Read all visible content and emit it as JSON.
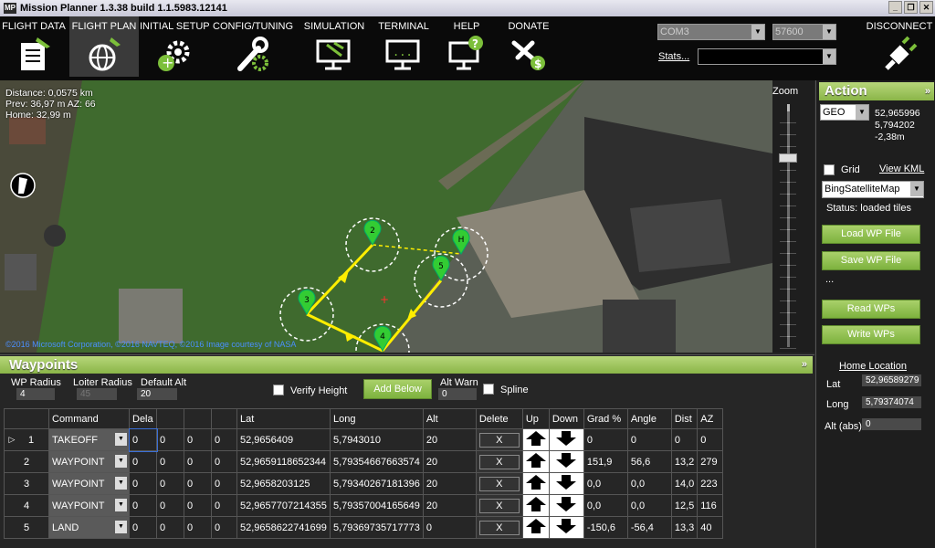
{
  "window": {
    "title": "Mission Planner 1.3.38 build 1.1.5983.12141",
    "logo": "MP"
  },
  "menu": [
    {
      "label": "FLIGHT DATA",
      "icon": "flight-data-icon"
    },
    {
      "label": "FLIGHT PLAN",
      "icon": "flight-plan-icon"
    },
    {
      "label": "INITIAL SETUP",
      "icon": "initial-setup-icon"
    },
    {
      "label": "CONFIG/TUNING",
      "icon": "config-tuning-icon"
    },
    {
      "label": "SIMULATION",
      "icon": "simulation-icon"
    },
    {
      "label": "TERMINAL",
      "icon": "terminal-icon"
    },
    {
      "label": "HELP",
      "icon": "help-icon"
    },
    {
      "label": "DONATE",
      "icon": "donate-icon"
    }
  ],
  "connection": {
    "port": "COM3",
    "baud": "57600",
    "stats_label": "Stats...",
    "disconnect_label": "DISCONNECT"
  },
  "map": {
    "distance": "Distance: 0,0575 km",
    "prev": "Prev: 36,97 m AZ: 66",
    "home": "Home: 32,99 m",
    "copyright": "©2016 Microsoft Corporation, ©2016 NAVTEQ, ©2016 Image courtesy of NASA",
    "markers": [
      "2",
      "3",
      "4",
      "5",
      "H"
    ],
    "zoom_label": "Zoom"
  },
  "action": {
    "title": "Action",
    "geo_option": "GEO",
    "coords": [
      "52,965996",
      "5,794202",
      "-2,38m"
    ],
    "grid_label": "Grid",
    "view_kml": "View KML",
    "map_provider": "BingSatelliteMap",
    "status": "Status: loaded tiles",
    "load_wp": "Load WP File",
    "save_wp": "Save WP File",
    "more": "...",
    "read_wps": "Read WPs",
    "write_wps": "Write WPs",
    "home_location": "Home Location",
    "lat_label": "Lat",
    "lat_value": "52,96589279",
    "long_label": "Long",
    "long_value": "5,79374074",
    "alt_label": "Alt (abs)",
    "alt_value": "0"
  },
  "waypoints": {
    "title": "Waypoints",
    "wp_radius_label": "WP Radius",
    "wp_radius": "4",
    "loiter_radius_label": "Loiter Radius",
    "loiter_radius": "45",
    "default_alt_label": "Default Alt",
    "default_alt": "20",
    "verify_height": "Verify Height",
    "add_below": "Add Below",
    "alt_warn_label": "Alt Warn",
    "alt_warn": "0",
    "spline": "Spline",
    "columns": [
      "",
      "Command",
      "Dela",
      "",
      "",
      "",
      "Lat",
      "Long",
      "Alt",
      "Delete",
      "Up",
      "Down",
      "Grad %",
      "Angle",
      "Dist",
      "AZ"
    ],
    "rows": [
      {
        "n": "1",
        "cmd": "TAKEOFF",
        "p1": "0",
        "p2": "0",
        "p3": "0",
        "p4": "0",
        "lat": "52,9656409",
        "lng": "5,7943010",
        "alt": "20",
        "del": "X",
        "grad": "0",
        "angle": "0",
        "dist": "0",
        "az": "0"
      },
      {
        "n": "2",
        "cmd": "WAYPOINT",
        "p1": "0",
        "p2": "0",
        "p3": "0",
        "p4": "0",
        "lat": "52,9659118652344",
        "lng": "5,79354667663574",
        "alt": "20",
        "del": "X",
        "grad": "151,9",
        "angle": "56,6",
        "dist": "13,2",
        "az": "279"
      },
      {
        "n": "3",
        "cmd": "WAYPOINT",
        "p1": "0",
        "p2": "0",
        "p3": "0",
        "p4": "0",
        "lat": "52,9658203125",
        "lng": "5,79340267181396",
        "alt": "20",
        "del": "X",
        "grad": "0,0",
        "angle": "0,0",
        "dist": "14,0",
        "az": "223"
      },
      {
        "n": "4",
        "cmd": "WAYPOINT",
        "p1": "0",
        "p2": "0",
        "p3": "0",
        "p4": "0",
        "lat": "52,9657707214355",
        "lng": "5,79357004165649",
        "alt": "20",
        "del": "X",
        "grad": "0,0",
        "angle": "0,0",
        "dist": "12,5",
        "az": "116"
      },
      {
        "n": "5",
        "cmd": "LAND",
        "p1": "0",
        "p2": "0",
        "p3": "0",
        "p4": "0",
        "lat": "52,9658622741699",
        "lng": "5,79369735717773",
        "alt": "0",
        "del": "X",
        "grad": "-150,6",
        "angle": "-56,4",
        "dist": "13,3",
        "az": "40"
      }
    ]
  },
  "colors": {
    "accent": "#8ab548",
    "path": "#ffee00",
    "marker": "#33cc33"
  }
}
